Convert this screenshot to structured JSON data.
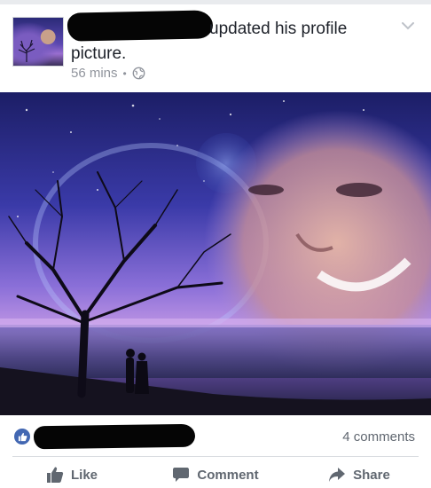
{
  "post": {
    "headline": "updated his profile",
    "headline_line2": "picture.",
    "timestamp": "56 mins",
    "separator": "•",
    "privacy_icon": "globe-icon",
    "menu_icon": "chevron-down-icon"
  },
  "reactions": {
    "reaction_icon": "like-icon",
    "comment_count": "4 comments"
  },
  "actions": {
    "like_label": "Like",
    "comment_label": "Comment",
    "share_label": "Share"
  },
  "colors": {
    "brand_blue": "#4267b2",
    "secondary_text": "#606770",
    "meta_text": "#90949c",
    "divider": "#dadde1"
  }
}
